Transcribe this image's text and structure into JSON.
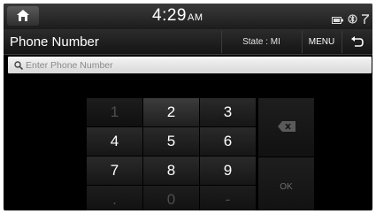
{
  "status_bar": {
    "time": "4:29",
    "ampm": "AM"
  },
  "title_bar": {
    "title": "Phone Number",
    "state": "State : MI",
    "menu": "MENU"
  },
  "search": {
    "placeholder": "Enter Phone Number",
    "value": ""
  },
  "keypad": {
    "keys": [
      "1",
      "2",
      "3",
      "4",
      "5",
      "6",
      "7",
      "8",
      "9",
      ".",
      "0",
      "-"
    ],
    "ok_label": "OK"
  }
}
